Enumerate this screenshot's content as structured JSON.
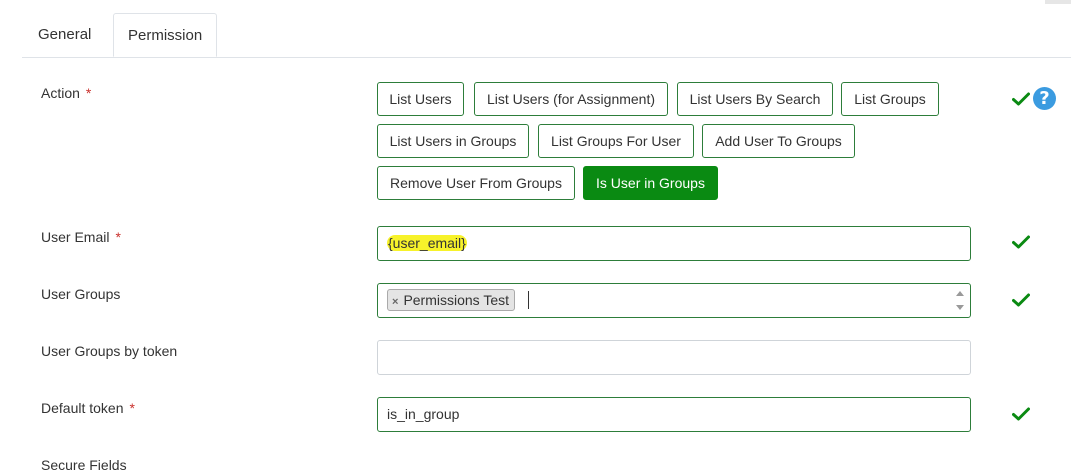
{
  "tabs": [
    {
      "label": "General"
    },
    {
      "label": "Permission"
    }
  ],
  "form": {
    "action": {
      "label": "Action",
      "required_mark": "*",
      "options": [
        "List Users",
        "List Users (for Assignment)",
        "List Users By Search",
        "List Groups",
        "List Users in Groups",
        "List Groups For User",
        "Add User To Groups",
        "Remove User From Groups",
        "Is User in Groups"
      ],
      "selected": "Is User in Groups",
      "help_glyph": "?"
    },
    "user_email": {
      "label": "User Email",
      "required_mark": "*",
      "value": "{user_email}"
    },
    "user_groups": {
      "label": "User Groups",
      "tags": [
        "Permissions Test"
      ],
      "tag_remove_glyph": "×"
    },
    "user_groups_token": {
      "label": "User Groups by token",
      "value": ""
    },
    "default_token": {
      "label": "Default token",
      "required_mark": "*",
      "value": "is_in_group"
    },
    "secure_fields": {
      "label": "Secure Fields"
    }
  },
  "colors": {
    "accent_green": "#0a8a12",
    "border_green": "#2d7d3a",
    "help_blue": "#3b9be0",
    "required_red": "#c9302c",
    "highlight_yellow": "#f7f22a"
  },
  "icons": {
    "valid": "check-icon",
    "help": "help-icon"
  }
}
